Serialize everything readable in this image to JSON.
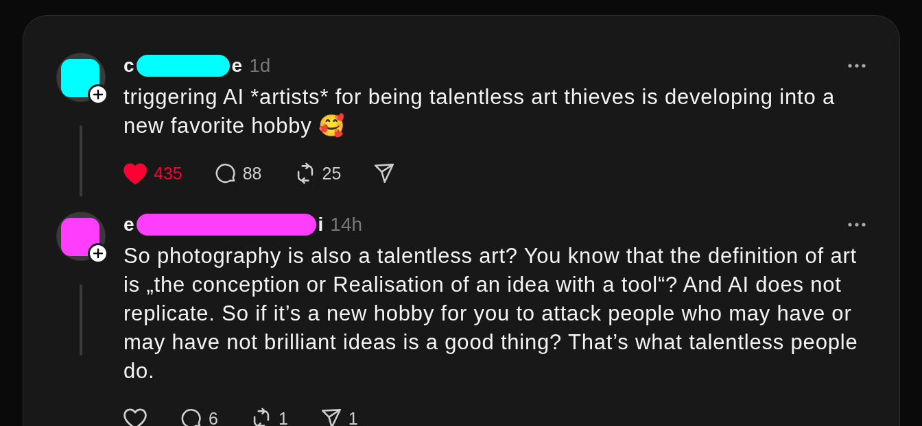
{
  "posts": [
    {
      "author": {
        "name_start": "c",
        "name_end": "e",
        "redaction": {
          "color": "#00ffff"
        }
      },
      "avatar": {
        "redaction": {
          "color": "#00ffff"
        }
      },
      "time": "1d",
      "text": "triggering AI *artists* for being talentless art thieves is developing into a new favorite hobby 🥰",
      "liked": true,
      "likes": "435",
      "replies": "88",
      "reposts": "25",
      "thread_line": true
    },
    {
      "author": {
        "name_start": "e",
        "name_end": "i",
        "redaction": {
          "color": "#ff3dfc"
        }
      },
      "avatar": {
        "redaction": {
          "color": "#ff3dfc"
        }
      },
      "time": "14h",
      "text": "So photography is also a talentless art? You know that the definition of art is „the conception or Realisation of an idea with a tool“? And AI does not replicate. So if it’s a new hobby for you to attack people who may have or may have not brilliant ideas is a good thing? That’s what talentless people do.",
      "liked": false,
      "replies": "6",
      "reposts": "1",
      "shares": "1",
      "thread_line": true
    }
  ]
}
